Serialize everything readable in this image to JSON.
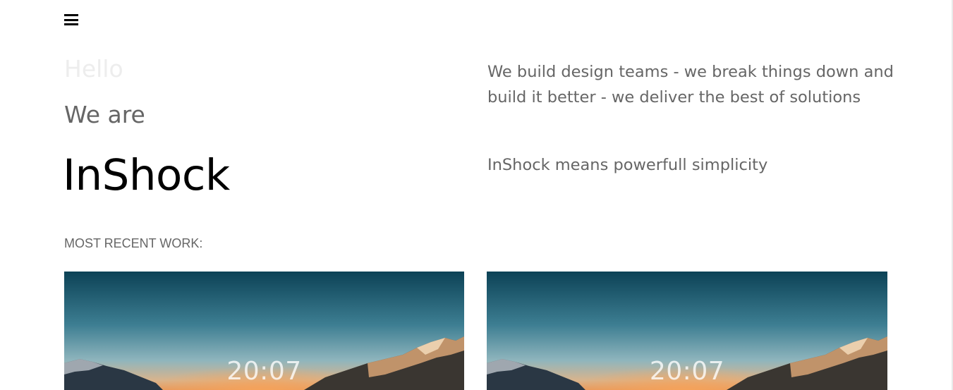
{
  "header": {
    "menu_icon": "hamburger-menu-icon"
  },
  "hero": {
    "greeting": "Hello",
    "intro": "We are",
    "brand": "InShock"
  },
  "about": {
    "tagline": "We build design teams - we break things down and build it better - we deliver the best of solutions",
    "subline": "InShock means powerfull simplicity"
  },
  "work": {
    "label": "MOST RECENT WORK:",
    "items": [
      {
        "time": "20:07",
        "image": "mountain-sunset-image"
      },
      {
        "time": "20:07",
        "image": "mountain-sunset-image"
      }
    ]
  },
  "colors": {
    "text_muted": "#666666",
    "greeting": "#ededed",
    "brand": "#000000"
  }
}
